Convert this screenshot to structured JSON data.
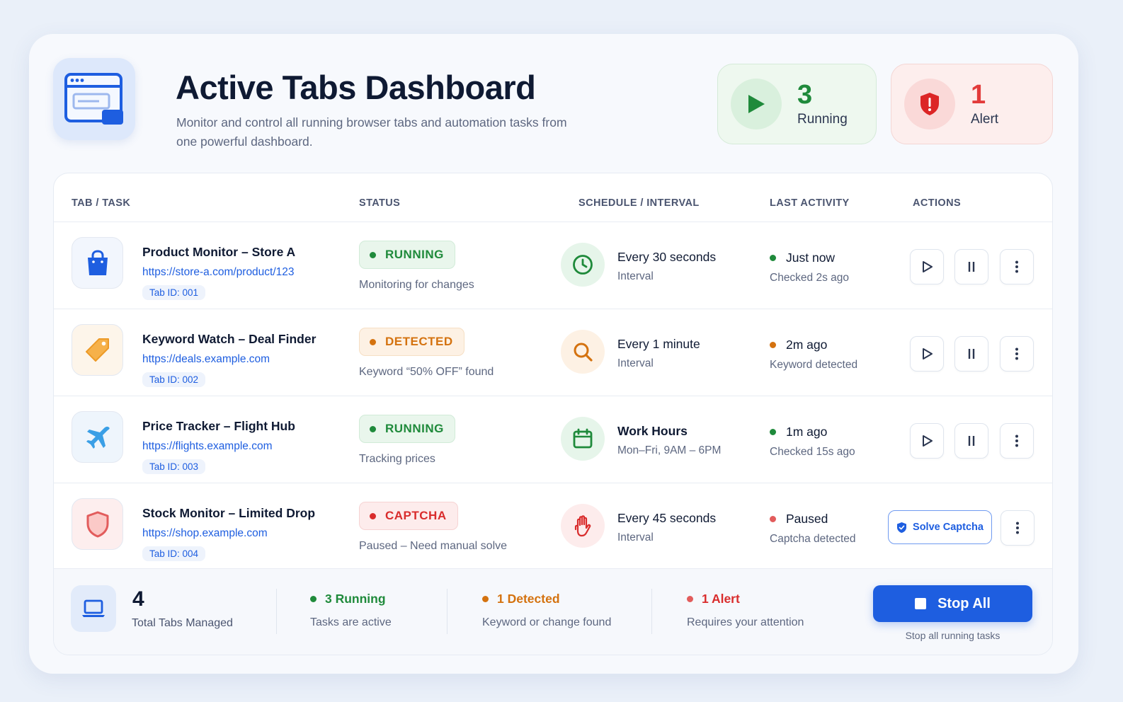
{
  "header": {
    "title": "Active Tabs Dashboard",
    "subtitle": "Monitor and control all running browser tabs and automation tasks from one powerful dashboard.",
    "logo_icon": "browser-window-icon"
  },
  "stats": {
    "running": {
      "value": "3",
      "label": "Running",
      "icon": "play-icon",
      "color": "#1f8a3b"
    },
    "alert": {
      "value": "1",
      "label": "Alert",
      "icon": "shield-alert-icon",
      "color": "#e23b3b"
    }
  },
  "table": {
    "headers": [
      "TAB / TASK",
      "STATUS",
      "SCHEDULE / INTERVAL",
      "LAST ACTIVITY",
      "ACTIONS"
    ],
    "rows": [
      {
        "name": "Product Monitor – Store A",
        "url": "https://store-a.com/product/123",
        "tab_id": "Tab ID: 001",
        "icon": "shopping-bag-icon",
        "status": "RUNNING",
        "status_desc": "Monitoring for changes",
        "schedule": "Every 30 seconds",
        "schedule_sub": "Interval",
        "schedule_icon": "clock-icon",
        "activity": "Just now",
        "activity_sub": "Checked 2s ago"
      },
      {
        "name": "Keyword Watch – Deal Finder",
        "url": "https://deals.example.com",
        "tab_id": "Tab ID: 002",
        "icon": "tag-icon",
        "status": "DETECTED",
        "status_desc": "Keyword “50% OFF” found",
        "schedule": "Every 1 minute",
        "schedule_sub": "Interval",
        "schedule_icon": "search-icon",
        "activity": "2m ago",
        "activity_sub": "Keyword detected"
      },
      {
        "name": "Price Tracker – Flight Hub",
        "url": "https://flights.example.com",
        "tab_id": "Tab ID: 003",
        "icon": "airplane-icon",
        "status": "RUNNING",
        "status_desc": "Tracking prices",
        "schedule": "Work Hours",
        "schedule_sub": "Mon–Fri, 9AM – 6PM",
        "schedule_icon": "calendar-icon",
        "activity": "1m ago",
        "activity_sub": "Checked 15s ago"
      },
      {
        "name": "Stock Monitor – Limited Drop",
        "url": "https://shop.example.com",
        "tab_id": "Tab ID: 004",
        "icon": "shield-icon",
        "status": "CAPTCHA",
        "status_desc": "Paused – Need manual solve",
        "schedule": "Every 45 seconds",
        "schedule_sub": "Interval",
        "schedule_icon": "hand-stop-icon",
        "activity": "Paused",
        "activity_sub": "Captcha detected",
        "action_label": "Solve Captcha"
      }
    ]
  },
  "footer": {
    "total": "4",
    "total_label": "Total Tabs Managed",
    "running": "3 Running",
    "running_sub": "Tasks are active",
    "detected": "1 Detected",
    "detected_sub": "Keyword or change found",
    "alert": "1 Alert",
    "alert_sub": "Requires your attention",
    "stop_label": "Stop All",
    "stop_note": "Stop all running tasks"
  },
  "colors": {
    "accent": "#1e5ee0",
    "running": "#1f8a3b",
    "detected": "#d4720f",
    "alert": "#d92c2c"
  }
}
